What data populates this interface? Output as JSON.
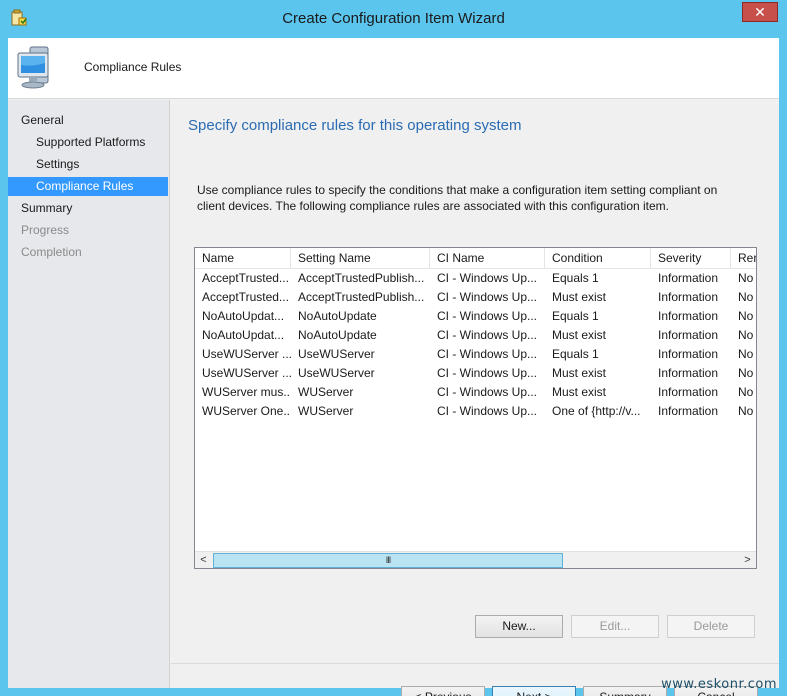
{
  "window": {
    "title": "Create Configuration Item Wizard"
  },
  "header": {
    "title": "Compliance Rules"
  },
  "nav": {
    "items": [
      {
        "label": "General",
        "level": "top",
        "state": "normal"
      },
      {
        "label": "Supported Platforms",
        "level": "sub",
        "state": "normal"
      },
      {
        "label": "Settings",
        "level": "sub",
        "state": "normal"
      },
      {
        "label": "Compliance Rules",
        "level": "sub",
        "state": "selected"
      },
      {
        "label": "Summary",
        "level": "top",
        "state": "normal"
      },
      {
        "label": "Progress",
        "level": "top",
        "state": "disabled"
      },
      {
        "label": "Completion",
        "level": "top",
        "state": "disabled"
      }
    ]
  },
  "page": {
    "title": "Specify compliance rules for this operating system",
    "description": "Use compliance rules to specify the conditions that make a configuration item setting compliant on client devices. The following compliance rules are associated with this configuration item."
  },
  "grid": {
    "columns": [
      "Name",
      "Setting Name",
      "CI Name",
      "Condition",
      "Severity",
      "Rer"
    ],
    "rows": [
      [
        "AcceptTrusted...",
        "AcceptTrustedPublish...",
        "CI - Windows Up...",
        "Equals 1",
        "Information",
        "No"
      ],
      [
        "AcceptTrusted...",
        "AcceptTrustedPublish...",
        "CI - Windows Up...",
        "Must exist",
        "Information",
        "No"
      ],
      [
        "NoAutoUpdat...",
        "NoAutoUpdate",
        "CI - Windows Up...",
        "Equals 1",
        "Information",
        "No"
      ],
      [
        "NoAutoUpdat...",
        "NoAutoUpdate",
        "CI - Windows Up...",
        "Must exist",
        "Information",
        "No"
      ],
      [
        "UseWUServer ...",
        "UseWUServer",
        "CI - Windows Up...",
        "Equals 1",
        "Information",
        "No"
      ],
      [
        "UseWUServer ...",
        "UseWUServer",
        "CI - Windows Up...",
        "Must exist",
        "Information",
        "No"
      ],
      [
        "WUServer mus...",
        "WUServer",
        "CI - Windows Up...",
        "Must exist",
        "Information",
        "No"
      ],
      [
        "WUServer One...",
        "WUServer",
        "CI - Windows Up...",
        "One of {http://v...",
        "Information",
        "No"
      ]
    ],
    "scroll_left": "<",
    "scroll_right": ">",
    "scroll_grip": "III"
  },
  "rule_buttons": {
    "new": "New...",
    "edit": "Edit...",
    "delete": "Delete"
  },
  "footer": {
    "previous": "< Previous",
    "next": "Next >",
    "summary": "Summary",
    "cancel": "Cancel"
  },
  "watermark": "www.eskonr.com",
  "colors": {
    "titlebar": "#5cc5ee",
    "selected_nav": "#3399ff",
    "page_title": "#2a6cb4",
    "close": "#c7504a"
  }
}
